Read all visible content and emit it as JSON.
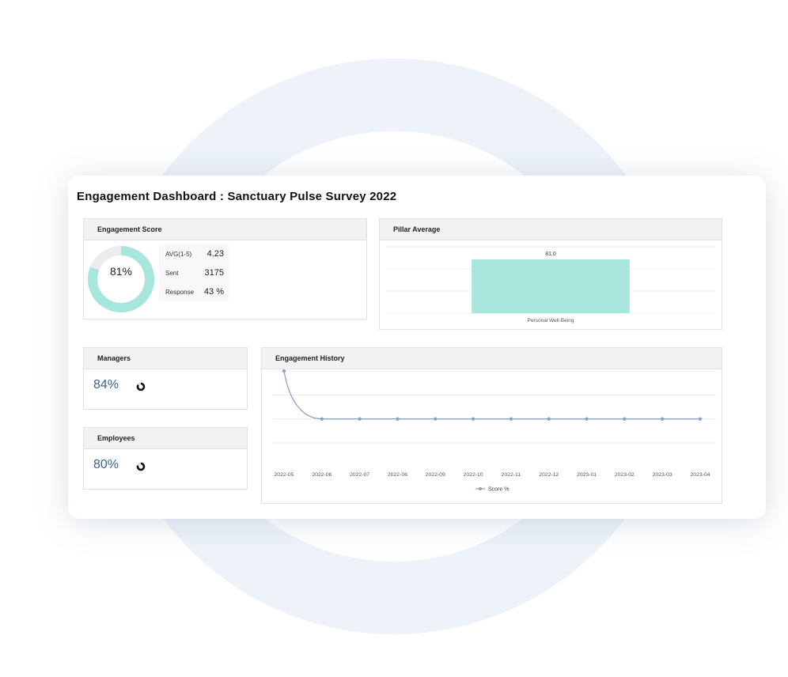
{
  "dashboard": {
    "title": "Engagement Dashboard : Sanctuary Pulse Survey 2022"
  },
  "engagement_score": {
    "title": "Engagement Score",
    "percent_label": "81%",
    "percent": 81,
    "stats": [
      {
        "label": "AVG(1-5)",
        "value": "4.23"
      },
      {
        "label": "Sent",
        "value": "3175"
      },
      {
        "label": "Response",
        "value": "43 %"
      }
    ]
  },
  "pillar_average": {
    "title": "Pillar Average"
  },
  "managers": {
    "title": "Managers",
    "value": "84%",
    "percent": 84
  },
  "employees": {
    "title": "Employees",
    "value": "80%",
    "percent": 80
  },
  "engagement_history": {
    "title": "Engagement History"
  },
  "colors": {
    "teal": "#a6e6dc",
    "line": "#8aa4c8",
    "value_blue": "#3d5f8c",
    "panel_header": "#f2f2f4"
  },
  "chart_data": [
    {
      "type": "bar",
      "title": "Pillar Average",
      "categories": [
        "Personal Well-Being"
      ],
      "values": [
        81.0
      ],
      "data_labels": [
        "81.0"
      ],
      "ylim": [
        0,
        100
      ],
      "grid": true
    },
    {
      "type": "line",
      "title": "Engagement History",
      "x": [
        "2022-05",
        "2022-06",
        "2022-07",
        "2022-08",
        "2022-09",
        "2022-10",
        "2022-11",
        "2022-12",
        "2023-01",
        "2023-02",
        "2023-03",
        "2023-04"
      ],
      "series": [
        {
          "name": "Score %",
          "values": [
            100,
            80,
            80,
            80,
            80,
            80,
            80,
            80,
            80,
            80,
            80,
            80
          ]
        }
      ],
      "ylim": [
        70,
        100
      ],
      "grid": true,
      "legend": "bottom"
    }
  ]
}
